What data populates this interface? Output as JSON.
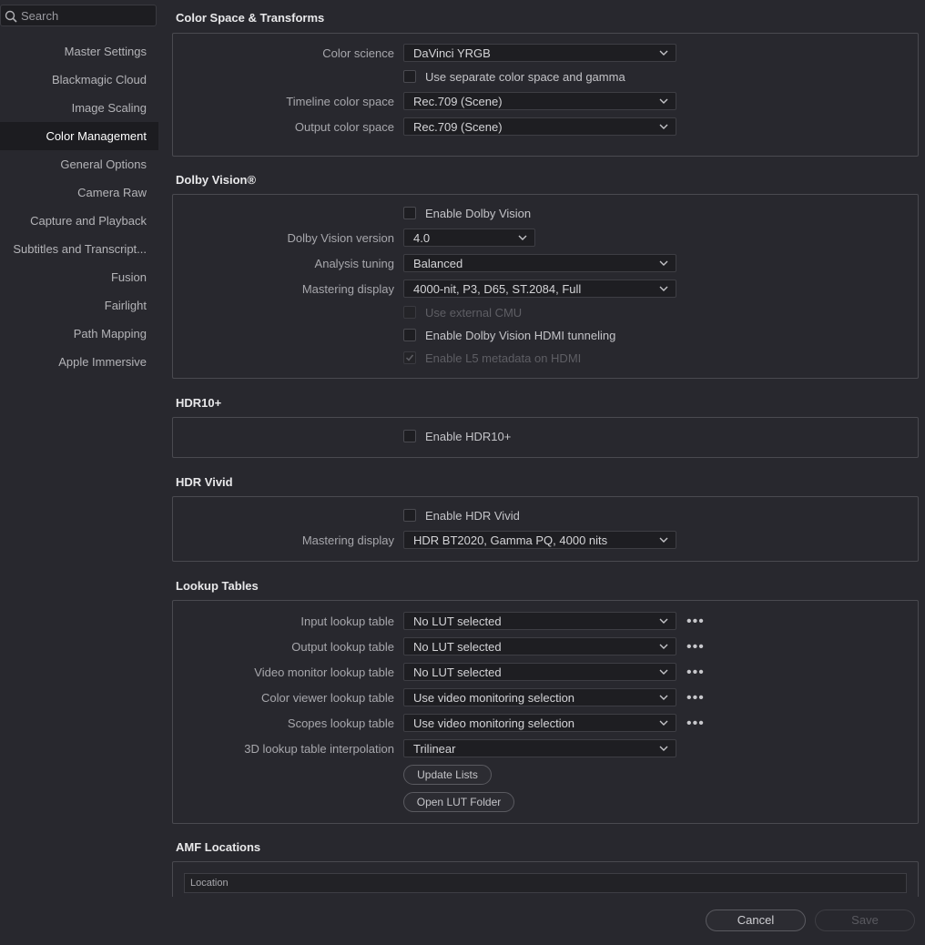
{
  "sidebar": {
    "search_placeholder": "Search",
    "items": [
      {
        "label": "Master Settings"
      },
      {
        "label": "Blackmagic Cloud"
      },
      {
        "label": "Image Scaling"
      },
      {
        "label": "Color Management"
      },
      {
        "label": "General Options"
      },
      {
        "label": "Camera Raw"
      },
      {
        "label": "Capture and Playback"
      },
      {
        "label": "Subtitles and Transcript..."
      },
      {
        "label": "Fusion"
      },
      {
        "label": "Fairlight"
      },
      {
        "label": "Path Mapping"
      },
      {
        "label": "Apple Immersive"
      }
    ],
    "active_item": "Color Management"
  },
  "color_space": {
    "title": "Color Space & Transforms",
    "color_science_label": "Color science",
    "color_science_value": "DaVinci YRGB",
    "separate_label": "Use separate color space and gamma",
    "separate_checked": false,
    "timeline_label": "Timeline color space",
    "timeline_value": "Rec.709 (Scene)",
    "output_label": "Output color space",
    "output_value": "Rec.709 (Scene)"
  },
  "dolby": {
    "title": "Dolby Vision®",
    "enable_label": "Enable Dolby Vision",
    "version_label": "Dolby Vision version",
    "version_value": "4.0",
    "analysis_label": "Analysis tuning",
    "analysis_value": "Balanced",
    "mastering_label": "Mastering display",
    "mastering_value": "4000-nit, P3, D65, ST.2084, Full",
    "external_cmu_label": "Use external CMU",
    "hdmi_label": "Enable Dolby Vision HDMI tunneling",
    "l5_label": "Enable L5 metadata on HDMI"
  },
  "hdr10": {
    "title": "HDR10+",
    "enable_label": "Enable HDR10+"
  },
  "hdr_vivid": {
    "title": "HDR Vivid",
    "enable_label": "Enable HDR Vivid",
    "mastering_label": "Mastering display",
    "mastering_value": "HDR BT2020, Gamma PQ, 4000 nits"
  },
  "luts": {
    "title": "Lookup Tables",
    "input_label": "Input lookup table",
    "input_value": "No LUT selected",
    "output_label": "Output lookup table",
    "output_value": "No LUT selected",
    "video_label": "Video monitor lookup table",
    "video_value": "No LUT selected",
    "viewer_label": "Color viewer lookup table",
    "viewer_value": "Use video monitoring selection",
    "scopes_label": "Scopes lookup table",
    "scopes_value": "Use video monitoring selection",
    "interp_label": "3D lookup table interpolation",
    "interp_value": "Trilinear",
    "more_glyph": "•••",
    "update_label": "Update Lists",
    "open_folder_label": "Open LUT Folder"
  },
  "amf": {
    "title": "AMF Locations",
    "column_location": "Location"
  },
  "footer": {
    "cancel_label": "Cancel",
    "save_label": "Save"
  }
}
